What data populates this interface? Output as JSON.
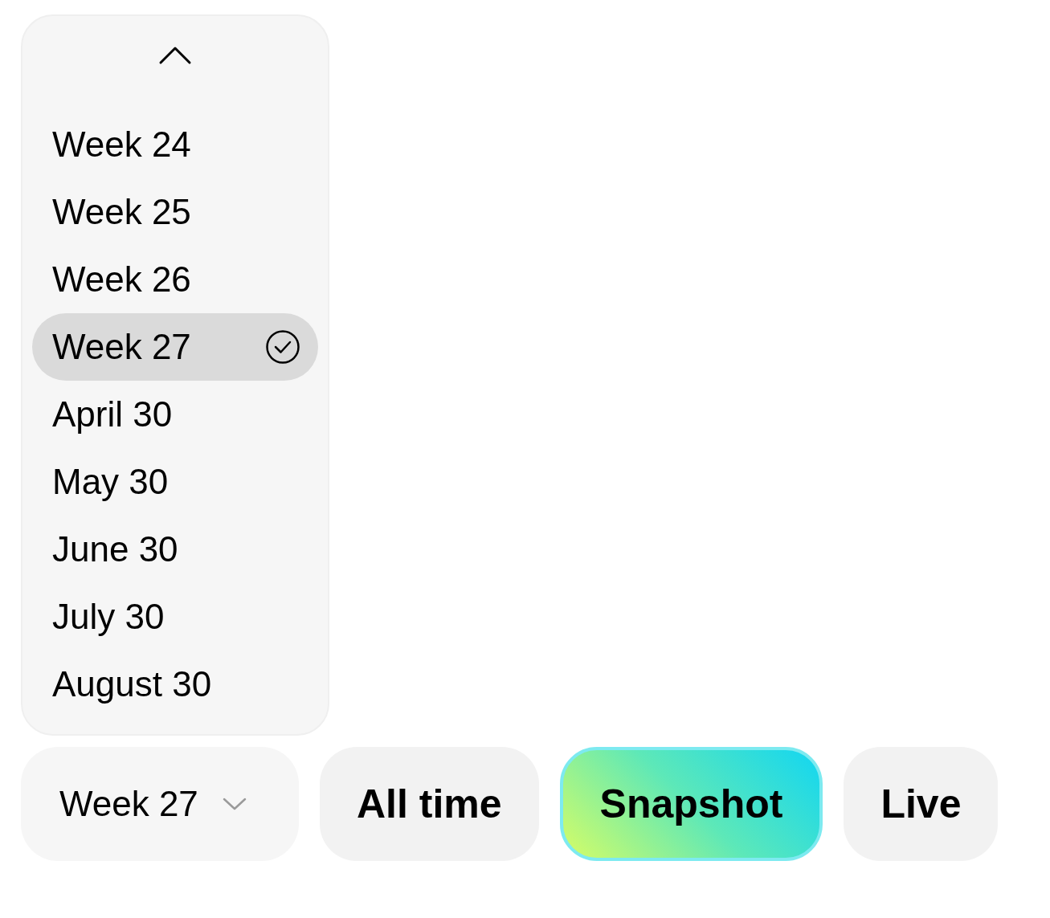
{
  "dropdown": {
    "items": [
      {
        "label": "Week 24",
        "selected": false
      },
      {
        "label": "Week 25",
        "selected": false
      },
      {
        "label": "Week 26",
        "selected": false
      },
      {
        "label": "Week 27",
        "selected": true
      },
      {
        "label": "April 30",
        "selected": false
      },
      {
        "label": "May 30",
        "selected": false
      },
      {
        "label": "June 30",
        "selected": false
      },
      {
        "label": "July 30",
        "selected": false
      },
      {
        "label": "August 30",
        "selected": false
      }
    ]
  },
  "select": {
    "value": "Week 27"
  },
  "modes": [
    {
      "label": "All time",
      "selected": false
    },
    {
      "label": "Snapshot",
      "selected": true
    },
    {
      "label": "Live",
      "selected": false
    }
  ]
}
